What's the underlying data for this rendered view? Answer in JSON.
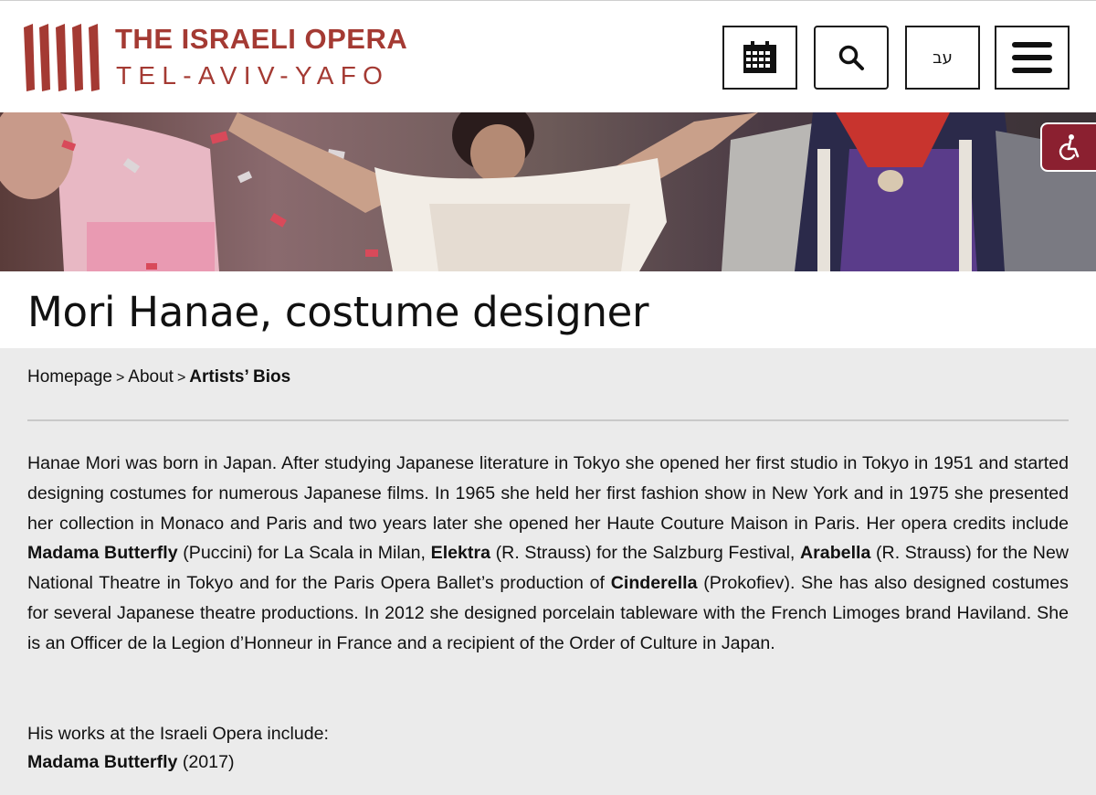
{
  "header": {
    "logo_line1": "THE ISRAELI OPERA",
    "logo_line2": "TEL-AVIV-YAFO",
    "calendar_icon": "calendar-icon",
    "search_icon": "search-icon",
    "language_label": "עב",
    "menu_icon": "hamburger-menu-icon",
    "brand_color": "#a43a33"
  },
  "accessibility": {
    "icon": "wheelchair-accessibility-icon",
    "color": "#8b2030"
  },
  "page": {
    "title": "Mori Hanae, costume designer"
  },
  "breadcrumb": {
    "items": [
      "Homepage",
      "About"
    ],
    "separator": ">",
    "current": "Artists’ Bios"
  },
  "bio": {
    "p1": "Hanae Mori was born in Japan. After studying Japanese literature in Tokyo she opened her first studio in Tokyo in 1951 and started designing costumes for numerous Japanese films. In 1965 she held her first fashion show in New York and in 1975 she presented her collection in Monaco and Paris and two years later she opened her Haute Couture Maison in Paris. Her opera credits include ",
    "w1": "Madama Butterfly",
    "p2": " (Puccini) for La Scala in Milan, ",
    "w2": "Elektra",
    "p3": " (R. Strauss) for the Salzburg Festival, ",
    "w3": "Arabella",
    "p4": " (R. Strauss) for the New National Theatre in Tokyo and for the Paris Opera Ballet’s production of ",
    "w4": "Cinderella",
    "p5": " (Prokofiev). She has also designed costumes for several Japanese theatre productions. In 2012 she designed porcelain tableware with the French Limoges brand Haviland. She is an Officer de la Legion d’Honneur in France and a recipient of the Order of Culture in Japan."
  },
  "works": {
    "intro": "His works at the Israeli Opera include:",
    "items": [
      {
        "title": "Madama Butterfly",
        "year": "(2017)"
      }
    ]
  }
}
